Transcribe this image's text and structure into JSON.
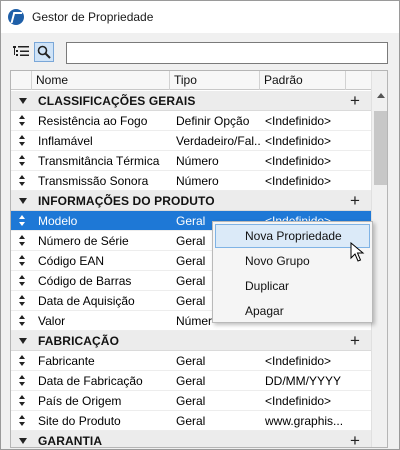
{
  "window": {
    "title": "Gestor de Propriedade"
  },
  "toolbar": {
    "search_value": "",
    "search_placeholder": ""
  },
  "columns": {
    "name": "Nome",
    "type": "Tipo",
    "default": "Padrão"
  },
  "groups": [
    {
      "label": "CLASSIFICAÇÕES GERAIS",
      "rows": [
        {
          "name": "Resistência ao Fogo",
          "type": "Definir Opção",
          "default": "<Indefinido>"
        },
        {
          "name": "Inflamável",
          "type": "Verdadeiro/Fal...",
          "default": "<Indefinido>"
        },
        {
          "name": "Transmitância Térmica",
          "type": "Número",
          "default": "<Indefinido>"
        },
        {
          "name": "Transmissão Sonora",
          "type": "Número",
          "default": "<Indefinido>"
        }
      ]
    },
    {
      "label": "INFORMAÇÕES DO PRODUTO",
      "rows": [
        {
          "name": "Modelo",
          "type": "Geral",
          "default": "<Indefinido>"
        },
        {
          "name": "Número de Série",
          "type": "Geral",
          "default": ""
        },
        {
          "name": "Código EAN",
          "type": "Geral",
          "default": ""
        },
        {
          "name": "Código de Barras",
          "type": "Geral",
          "default": ""
        },
        {
          "name": "Data de Aquisição",
          "type": "Geral",
          "default": ""
        },
        {
          "name": "Valor",
          "type": "Númer",
          "default": ""
        }
      ]
    },
    {
      "label": "FABRICAÇÃO",
      "rows": [
        {
          "name": "Fabricante",
          "type": "Geral",
          "default": "<Indefinido>"
        },
        {
          "name": "Data de Fabricação",
          "type": "Geral",
          "default": "DD/MM/YYYY"
        },
        {
          "name": "País de Origem",
          "type": "Geral",
          "default": "<Indefinido>"
        },
        {
          "name": "Site do Produto",
          "type": "Geral",
          "default": "www.graphis..."
        }
      ]
    },
    {
      "label": "GARANTIA",
      "rows": []
    }
  ],
  "context_menu": {
    "items": [
      "Nova Propriedade",
      "Novo Grupo",
      "Duplicar",
      "Apagar"
    ]
  },
  "add_symbol": "+",
  "colors": {
    "selection": "#1e78d6",
    "menu_hover": "#dbeaf8",
    "app_icon": "#1f5fa8"
  }
}
